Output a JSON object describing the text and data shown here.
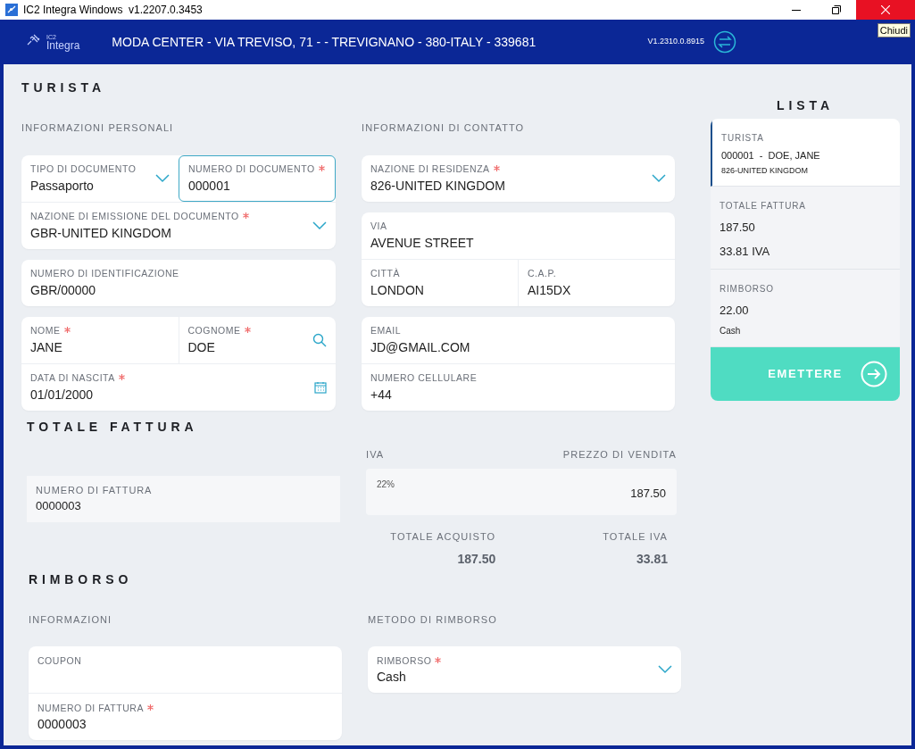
{
  "window": {
    "title": "IC2 Integra Windows  v1.2207.0.3453",
    "close_tooltip": "Chiudi"
  },
  "header": {
    "logo_small": "IC2",
    "logo": "Integra",
    "store": "MODA CENTER - VIA TREVISO, 71 - - TREVIGNANO - 380-ITALY - 339681",
    "version": "V1.2310.0.8915"
  },
  "turista": {
    "title": "TURISTA",
    "personal": {
      "heading": "INFORMAZIONI PERSONALI",
      "cards": [
        {
          "rows": [
            [
              {
                "label": "TIPO DI DOCUMENTO",
                "value": "Passaporto",
                "kind": "select",
                "required": false,
                "focused": false
              },
              {
                "label": "NUMERO DI DOCUMENTO",
                "value": "000001",
                "required": true,
                "focused": true
              }
            ],
            [
              {
                "label": "NAZIONE DI EMISSIONE DEL DOCUMENTO",
                "value": "GBR-UNITED KINGDOM",
                "kind": "select",
                "required": true,
                "focused": false
              }
            ]
          ]
        },
        {
          "rows": [
            [
              {
                "label": "NUMERO DI IDENTIFICAZIONE",
                "value": "GBR/00000",
                "required": false,
                "focused": false
              }
            ]
          ]
        },
        {
          "rows": [
            [
              {
                "label": "NOME",
                "value": "JANE",
                "required": true,
                "focused": false
              },
              {
                "label": "COGNOME",
                "value": "DOE",
                "kind": "search",
                "required": true,
                "focused": false
              }
            ],
            [
              {
                "label": "DATA DI NASCITA",
                "value": "01/01/2000",
                "kind": "date",
                "required": true,
                "focused": false
              }
            ]
          ]
        }
      ]
    },
    "contact": {
      "heading": "INFORMAZIONI DI CONTATTO",
      "cards": [
        {
          "rows": [
            [
              {
                "label": "NAZIONE DI RESIDENZA",
                "value": "826-UNITED KINGDOM",
                "kind": "select",
                "required": true,
                "focused": false
              }
            ]
          ]
        },
        {
          "rows": [
            [
              {
                "label": "VIA",
                "value": "AVENUE STREET",
                "required": false,
                "focused": false
              }
            ],
            [
              {
                "label": "CITTÀ",
                "value": "LONDON",
                "required": false,
                "focused": false
              },
              {
                "label": "C.A.P.",
                "value": "AI15DX",
                "required": false,
                "focused": false
              }
            ]
          ]
        },
        {
          "rows": [
            [
              {
                "label": "EMAIL",
                "value": "JD@GMAIL.COM",
                "required": false,
                "focused": false
              }
            ],
            [
              {
                "label": "NUMERO CELLULARE",
                "value": "+44",
                "required": false,
                "focused": false
              }
            ]
          ]
        }
      ]
    }
  },
  "totale": {
    "title": "TOTALE FATTURA",
    "invoice": {
      "label": "NUMERO DI FATTURA",
      "value": "0000003"
    },
    "iva_heading": "IVA",
    "price_heading": "PREZZO DI VENDITA",
    "rate": "22%",
    "price": "187.50",
    "totals": [
      {
        "label": "TOTALE ACQUISTO",
        "value": "187.50"
      },
      {
        "label": "TOTALE IVA",
        "value": "33.81"
      }
    ]
  },
  "rimborso": {
    "title": "RIMBORSO",
    "info": {
      "heading": "INFORMAZIONI",
      "cards": [
        {
          "rows": [
            [
              {
                "label": "COUPON",
                "required": false,
                "focused": false
              }
            ],
            [
              {
                "label": "NUMERO DI FATTURA",
                "value": "0000003",
                "required": true,
                "focused": false
              }
            ]
          ]
        }
      ]
    },
    "method": {
      "heading": "METODO DI RIMBORSO",
      "cards": [
        {
          "rows": [
            [
              {
                "label": "RIMBORSO",
                "value": "Cash",
                "kind": "select",
                "required": true,
                "focused": false
              }
            ]
          ]
        }
      ]
    }
  },
  "lista": {
    "title": "LISTA",
    "items": [
      {
        "kind": "tourist",
        "selected": true,
        "label": "TURISTA",
        "lines": [
          "000001  -  DOE, JANE",
          "826-UNITED KINGDOM"
        ]
      },
      {
        "kind": "amount",
        "selected": false,
        "label": "TOTALE FATTURA",
        "lines": [
          "187.50",
          "33.81 IVA"
        ]
      },
      {
        "kind": "refund",
        "selected": false,
        "label": "RIMBORSO",
        "lines": [
          "22.00",
          "Cash"
        ]
      }
    ],
    "button": "EMETTERE"
  }
}
